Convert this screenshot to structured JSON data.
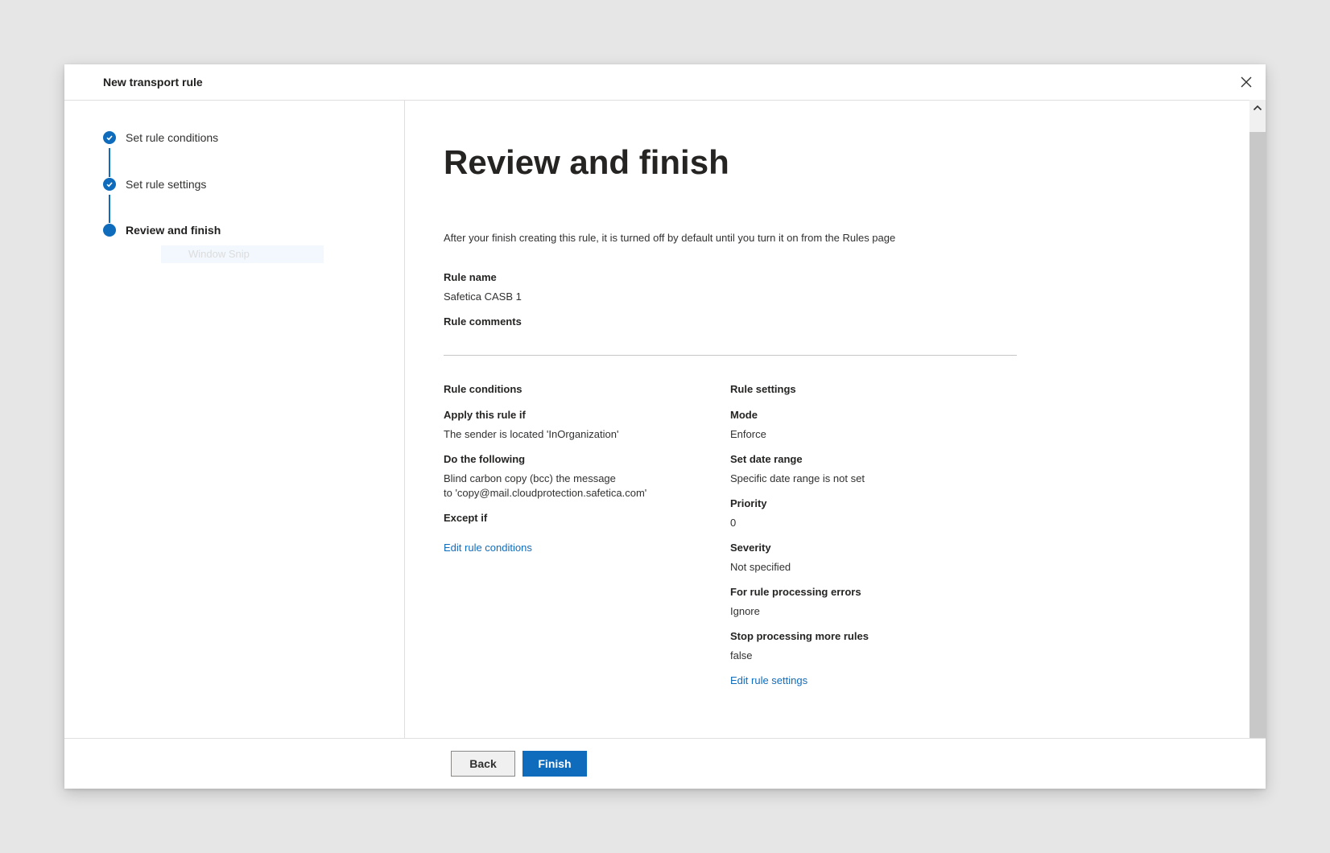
{
  "dialog": {
    "title": "New transport rule",
    "close_icon": "close-icon"
  },
  "steps": [
    {
      "label": "Set rule conditions",
      "state": "complete"
    },
    {
      "label": "Set rule settings",
      "state": "complete"
    },
    {
      "label": "Review and finish",
      "state": "current"
    }
  ],
  "overlay": {
    "ghost_text": "Window Snip"
  },
  "review": {
    "title": "Review and finish",
    "intro": "After your finish creating this rule, it is turned off by default until you turn it on from the Rules page",
    "rule_name_label": "Rule name",
    "rule_name_value": "Safetica CASB 1",
    "rule_comments_label": "Rule comments"
  },
  "conditions": {
    "heading": "Rule conditions",
    "apply_label": "Apply this rule if",
    "apply_value": "The sender is located 'InOrganization'",
    "do_label": "Do the following",
    "do_value_line1": "Blind carbon copy (bcc) the message",
    "do_value_line2": "to 'copy@mail.cloudprotection.safetica.com'",
    "except_label": "Except if",
    "edit_link": "Edit rule conditions"
  },
  "settings": {
    "heading": "Rule settings",
    "mode_label": "Mode",
    "mode_value": "Enforce",
    "date_label": "Set date range",
    "date_value": "Specific date range is not set",
    "priority_label": "Priority",
    "priority_value": "0",
    "severity_label": "Severity",
    "severity_value": "Not specified",
    "errors_label": "For rule processing errors",
    "errors_value": "Ignore",
    "stop_label": "Stop processing more rules",
    "stop_value": "false",
    "edit_link": "Edit rule settings"
  },
  "footer": {
    "back_label": "Back",
    "finish_label": "Finish"
  },
  "colors": {
    "accent": "#0f6cbd",
    "link": "#0f6cbd",
    "background": "#e6e6e6"
  }
}
